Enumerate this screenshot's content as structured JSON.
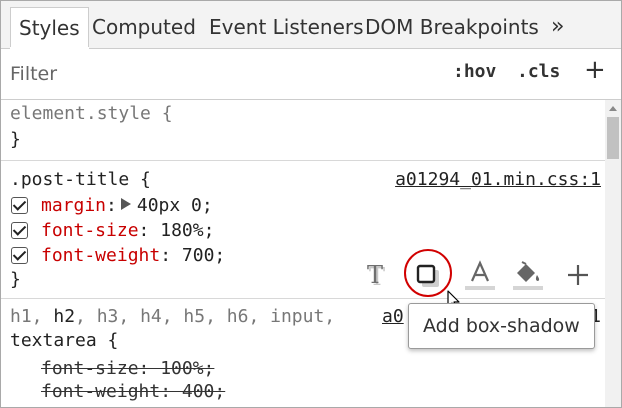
{
  "tabs": {
    "styles": "Styles",
    "computed": "Computed",
    "event_listeners": "Event Listeners",
    "dom_breakpoints": "DOM Breakpoints",
    "more": "»"
  },
  "filter": {
    "placeholder": "Filter",
    "hov": ":hov",
    "cls": ".cls",
    "add": "+"
  },
  "rules": {
    "element_style": {
      "selector": "element.style {",
      "close": "}"
    },
    "post_title": {
      "selector": ".post-title {",
      "source": "a01294_01.min.css:1",
      "decls": [
        {
          "prop": "margin",
          "value": "40px 0;",
          "expandable": true
        },
        {
          "prop": "font-size",
          "value": "180%;"
        },
        {
          "prop": "font-weight",
          "value": "700;"
        }
      ],
      "close": "}"
    },
    "headings": {
      "selector_parts": [
        "h1, ",
        "h2",
        ", h3, h4, h5, h6, input,"
      ],
      "selector_line2": "textarea {",
      "source_partial": "a0",
      "source_tail": "1",
      "decls": [
        {
          "text": "font-size: 100%;"
        },
        {
          "text": "font-weight: 400;"
        }
      ]
    }
  },
  "toolbar": {
    "icons": [
      "text-shadow-icon",
      "box-shadow-icon",
      "text-color-icon",
      "background-color-icon",
      "add-icon"
    ],
    "highlight_color": "#d10000"
  },
  "tooltip": {
    "text": "Add box-shadow"
  }
}
